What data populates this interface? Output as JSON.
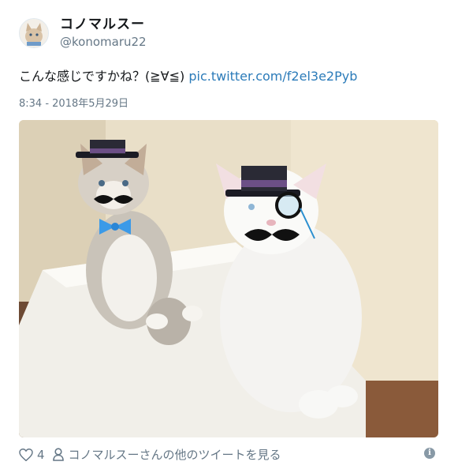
{
  "tweet": {
    "author": {
      "display_name": "コノマルスー",
      "handle": "@konomaru22"
    },
    "text": "こんな感じですかね？(≧∀≦) ",
    "link": "pic.twitter.com/f2el3e2Pyb",
    "timestamp": "8:34 - 2018年5月29日"
  },
  "footer": {
    "like_count": "4",
    "more_tweets_label": "コノマルスーさんの他のツイートを見る",
    "info_glyph": "i"
  },
  "icons": [
    "heart-icon",
    "person-icon",
    "info-icon"
  ],
  "colors": {
    "link": "#2b7bb9",
    "secondary_text": "#657786"
  }
}
